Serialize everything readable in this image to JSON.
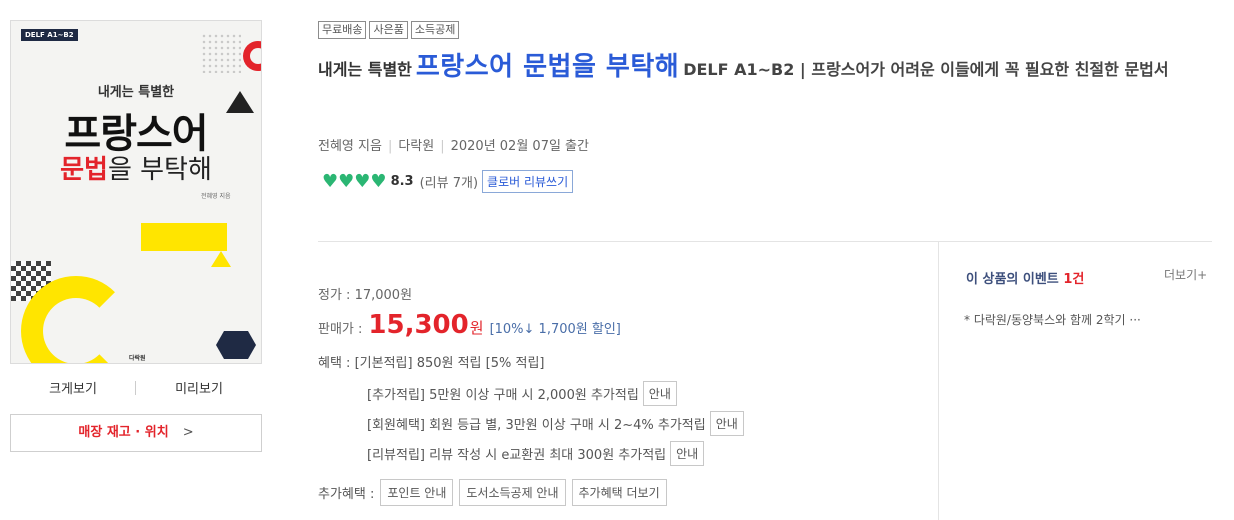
{
  "cover": {
    "series": "DELF A1~B2",
    "subtitle": "내게는 특별한",
    "title_line1": "프랑스어",
    "title_line2_red": "문법",
    "title_line2_rest": "을 부탁해",
    "author": "전혜영 지음",
    "publisher": "다락원"
  },
  "cover_links": {
    "zoom": "크게보기",
    "preview": "미리보기"
  },
  "store_button": {
    "label": "매장 재고 · 위치",
    "chevron": ">"
  },
  "tags": [
    "무료배송",
    "사은품",
    "소득공제"
  ],
  "title": {
    "prefix": "내게는 특별한",
    "main": "프랑스어 문법을 부탁해",
    "subtitle": "DELF A1~B2 | 프랑스어가 어려운 이들에게 꼭 필요한 친절한 문법서"
  },
  "meta": {
    "author": "전혜영 지음",
    "publisher": "다락원",
    "date": "2020년 02월 07일 출간"
  },
  "rating": {
    "hearts": 4,
    "score": "8.3",
    "count": "(리뷰 7개)",
    "review_button": "클로버 리뷰쓰기"
  },
  "price": {
    "list_label": "정가 :",
    "list_value": "17,000원",
    "sale_label": "판매가 :",
    "sale_value": "15,300",
    "sale_unit": "원",
    "discount": "[10%↓ 1,700원 할인]"
  },
  "benefits": {
    "label": "혜택 :",
    "basic": "[기본적립] 850원 적립 [5% 적립]",
    "extra": "[추가적립] 5만원 이상 구매 시 2,000원 추가적립",
    "member": "[회원혜택] 회원 등급 별, 3만원 이상 구매 시 2~4% 추가적립",
    "review": "[리뷰적립] 리뷰 작성 시 e교환권 최대 300원 추가적립",
    "info_button": "안내"
  },
  "extra_benefits": {
    "label": "추가혜택 :",
    "buttons": [
      "포인트 안내",
      "도서소득공제 안내",
      "추가혜택 더보기"
    ]
  },
  "events": {
    "title": "이 상품의 이벤트",
    "count": "1건",
    "more": "더보기+",
    "items": [
      "* 다락원/동양북스와 함께 2학기 ···"
    ]
  },
  "colors": {
    "title_blue": "#2a5bd7",
    "price_red": "#e3242b",
    "heart_green": "#2bb673",
    "event_navy": "#3d4f7c"
  }
}
